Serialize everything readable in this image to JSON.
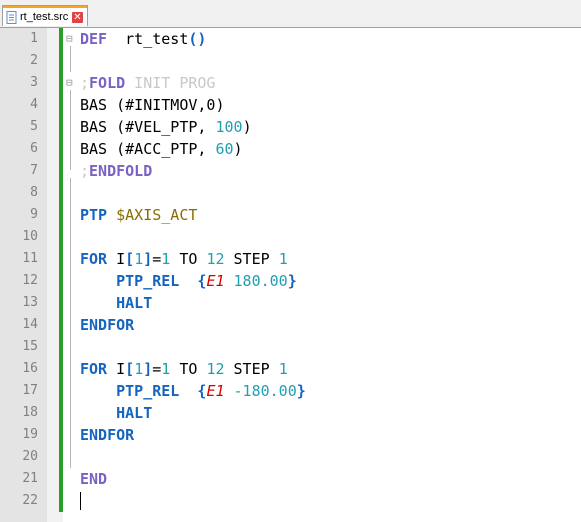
{
  "tab": {
    "label": "rt_test.src",
    "close_glyph": "✕"
  },
  "colors": {
    "keyword": "#1565c0",
    "fold_keyword": "#7a62c4",
    "number": "#1f9fb1",
    "e1": "#d90000",
    "change_bar": "#2a9d2a",
    "cursor_line": "#e4e4e4"
  },
  "lines": [
    {
      "n": "1",
      "tokens": [
        [
          "kw2",
          "DEF"
        ],
        [
          "",
          "  rt_test"
        ],
        [
          "br",
          "()"
        ]
      ]
    },
    {
      "n": "2",
      "tokens": []
    },
    {
      "n": "3",
      "tokens": [
        [
          "cm",
          ";"
        ],
        [
          "kw2",
          "FOLD"
        ],
        [
          "cm",
          " INIT PROG"
        ]
      ]
    },
    {
      "n": "4",
      "tokens": [
        [
          "",
          "BAS (#INITMOV,0)"
        ]
      ]
    },
    {
      "n": "5",
      "tokens": [
        [
          "",
          "BAS (#VEL_PTP, "
        ],
        [
          "num",
          "100"
        ],
        [
          "",
          ")"
        ]
      ]
    },
    {
      "n": "6",
      "tokens": [
        [
          "",
          "BAS (#ACC_PTP, "
        ],
        [
          "num",
          "60"
        ],
        [
          "",
          ")"
        ]
      ]
    },
    {
      "n": "7",
      "tokens": [
        [
          "cm",
          ";"
        ],
        [
          "kw2",
          "ENDFOLD"
        ]
      ]
    },
    {
      "n": "8",
      "tokens": []
    },
    {
      "n": "9",
      "tokens": [
        [
          "kw",
          "PTP"
        ],
        [
          "",
          " "
        ],
        [
          "sys",
          "$AXIS_ACT"
        ]
      ]
    },
    {
      "n": "10",
      "tokens": []
    },
    {
      "n": "11",
      "tokens": [
        [
          "kw",
          "FOR"
        ],
        [
          "",
          " I"
        ],
        [
          "br",
          "["
        ],
        [
          "num",
          "1"
        ],
        [
          "br",
          "]"
        ],
        [
          "",
          "="
        ],
        [
          "num",
          "1"
        ],
        [
          "",
          " TO "
        ],
        [
          "num",
          "12"
        ],
        [
          "",
          " STEP "
        ],
        [
          "num",
          "1"
        ]
      ]
    },
    {
      "n": "12",
      "tokens": [
        [
          "",
          "    "
        ],
        [
          "mot",
          "PTP_REL"
        ],
        [
          "",
          "  "
        ],
        [
          "br",
          "{"
        ],
        [
          "e1",
          "E1"
        ],
        [
          "",
          " "
        ],
        [
          "num",
          "180.00"
        ],
        [
          "br",
          "}"
        ]
      ]
    },
    {
      "n": "13",
      "tokens": [
        [
          "",
          "    "
        ],
        [
          "kw",
          "HALT"
        ]
      ]
    },
    {
      "n": "14",
      "tokens": [
        [
          "kw",
          "ENDFOR"
        ]
      ]
    },
    {
      "n": "15",
      "tokens": []
    },
    {
      "n": "16",
      "tokens": [
        [
          "kw",
          "FOR"
        ],
        [
          "",
          " I"
        ],
        [
          "br",
          "["
        ],
        [
          "num",
          "1"
        ],
        [
          "br",
          "]"
        ],
        [
          "",
          "="
        ],
        [
          "num",
          "1"
        ],
        [
          "",
          " TO "
        ],
        [
          "num",
          "12"
        ],
        [
          "",
          " STEP "
        ],
        [
          "num",
          "1"
        ]
      ]
    },
    {
      "n": "17",
      "tokens": [
        [
          "",
          "    "
        ],
        [
          "mot",
          "PTP_REL"
        ],
        [
          "",
          "  "
        ],
        [
          "br",
          "{"
        ],
        [
          "e1",
          "E1"
        ],
        [
          "",
          " "
        ],
        [
          "num",
          "-180.00"
        ],
        [
          "br",
          "}"
        ]
      ]
    },
    {
      "n": "18",
      "tokens": [
        [
          "",
          "    "
        ],
        [
          "kw",
          "HALT"
        ]
      ]
    },
    {
      "n": "19",
      "tokens": [
        [
          "kw",
          "ENDFOR"
        ]
      ]
    },
    {
      "n": "20",
      "tokens": []
    },
    {
      "n": "21",
      "tokens": [
        [
          "kw2",
          "END"
        ]
      ]
    },
    {
      "n": "22",
      "tokens": []
    }
  ]
}
